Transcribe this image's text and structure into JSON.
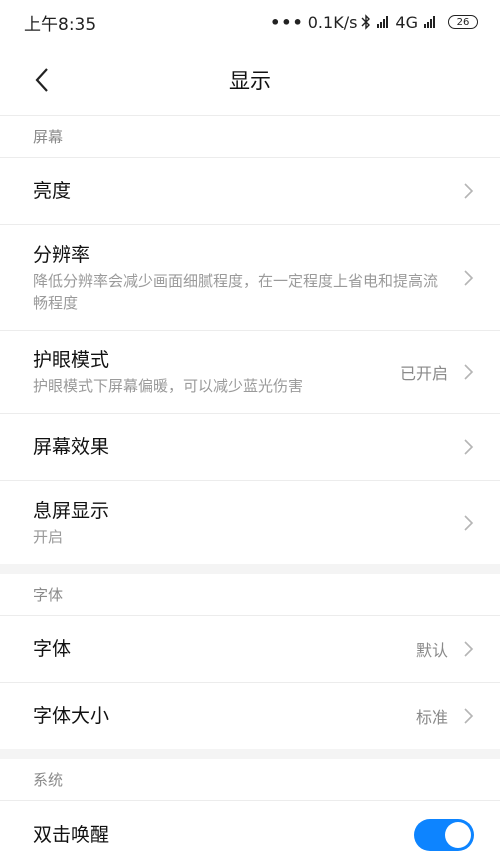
{
  "status_bar": {
    "time": "上午8:35",
    "net_speed": "0.1K/s",
    "network_type": "4G",
    "battery": "26",
    "icons": [
      "bluetooth-icon",
      "signal-hd-icon",
      "signal-icon",
      "battery-icon"
    ]
  },
  "header": {
    "title": "显示",
    "back_icon": "back-chevron-icon"
  },
  "sections": {
    "screen": {
      "header": "屏幕",
      "brightness": {
        "title": "亮度"
      },
      "resolution": {
        "title": "分辨率",
        "subtitle": "降低分辨率会减少画面细腻程度，在一定程度上省电和提高流畅程度"
      },
      "eye_care": {
        "title": "护眼模式",
        "subtitle": "护眼模式下屏幕偏暖，可以减少蓝光伤害",
        "value": "已开启"
      },
      "screen_effect": {
        "title": "屏幕效果"
      },
      "aod": {
        "title": "息屏显示",
        "subtitle": "开启"
      }
    },
    "font": {
      "header": "字体",
      "font": {
        "title": "字体",
        "value": "默认"
      },
      "font_size": {
        "title": "字体大小",
        "value": "标准"
      }
    },
    "system": {
      "header": "系统",
      "double_tap_wake": {
        "title": "双击唤醒",
        "enabled": true
      }
    }
  },
  "colors": {
    "accent": "#0d84ff",
    "divider": "#ececec",
    "secondary_text": "#9a9a9a"
  }
}
